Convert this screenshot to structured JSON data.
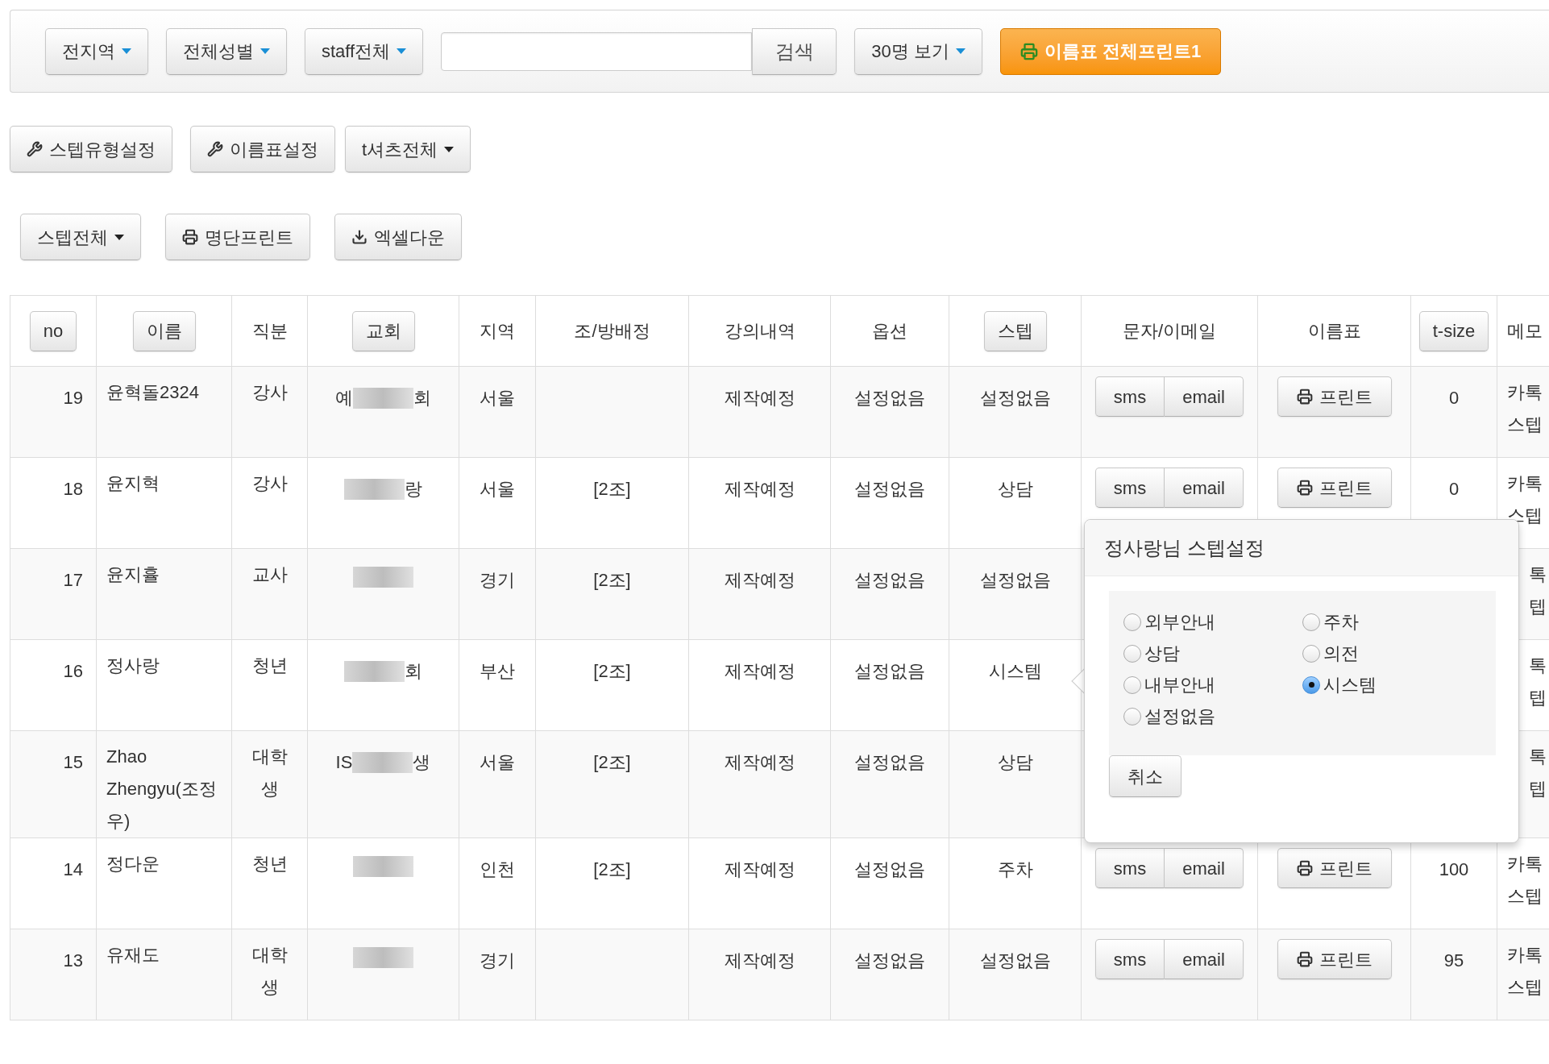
{
  "top_bar": [
    {
      "kind": "dropdown",
      "label": "전지역"
    },
    {
      "kind": "dropdown",
      "label": "전체성별"
    },
    {
      "kind": "dropdown",
      "label": "staff전체"
    },
    {
      "kind": "search",
      "label": "검색"
    },
    {
      "kind": "dropdown",
      "label": "30명 보기"
    },
    {
      "kind": "primary",
      "label": "이름표 전체프린트1"
    }
  ],
  "toolbar_1": [
    {
      "kind": "wrench",
      "label": "스텝유형설정"
    },
    {
      "kind": "wrench",
      "label": "이름표설정"
    },
    {
      "kind": "dropdown",
      "label": "t셔츠전체"
    }
  ],
  "toolbar_2": [
    {
      "kind": "dropdown",
      "label": "스텝전체"
    },
    {
      "kind": "print",
      "label": "명단프린트"
    },
    {
      "kind": "download",
      "label": "엑셀다운"
    }
  ],
  "table": {
    "columns": [
      {
        "label": "no",
        "kind": "button"
      },
      {
        "label": "이름",
        "kind": "button"
      },
      {
        "label": "직분",
        "kind": "text"
      },
      {
        "label": "교회",
        "kind": "button"
      },
      {
        "label": "지역",
        "kind": "text"
      },
      {
        "label": "조/방배정",
        "kind": "text"
      },
      {
        "label": "강의내역",
        "kind": "text"
      },
      {
        "label": "옵션",
        "kind": "text"
      },
      {
        "label": "스텝",
        "kind": "button"
      },
      {
        "label": "문자/이메일",
        "kind": "text"
      },
      {
        "label": "이름표",
        "kind": "text"
      },
      {
        "label": "t-size",
        "kind": "button"
      },
      {
        "label": "메모",
        "kind": "text"
      }
    ],
    "rows": [
      {
        "no": "19",
        "name": "윤혁돌2324",
        "role": "강사",
        "church": {
          "prefix": "예",
          "suffix": "회"
        },
        "region": "서울",
        "group": "",
        "lecture": "제작예정",
        "option": "설정없음",
        "step": "설정없음",
        "sms": "sms",
        "email": "email",
        "print": "프린트",
        "tsize": "0",
        "memo": [
          "카톡",
          "스텝"
        ]
      },
      {
        "no": "18",
        "name": "윤지혁",
        "role": "강사",
        "church": {
          "suffix": "랑"
        },
        "region": "서울",
        "group": "[2조]",
        "lecture": "제작예정",
        "option": "설정없음",
        "step": "상담",
        "sms": "sms",
        "email": "email",
        "print": "프린트",
        "tsize": "0",
        "memo": [
          "카톡",
          "스텝"
        ]
      },
      {
        "no": "17",
        "name": "윤지휼",
        "role": "교사",
        "church": {},
        "region": "경기",
        "group": "[2조]",
        "lecture": "제작예정",
        "option": "설정없음",
        "step": "설정없음",
        "memo": [
          "톡",
          "텝"
        ]
      },
      {
        "no": "16",
        "name": "정사랑",
        "role": "청년",
        "church": {
          "suffix": "회"
        },
        "region": "부산",
        "group": "[2조]",
        "lecture": "제작예정",
        "option": "설정없음",
        "step": "시스템",
        "memo": [
          "톡",
          "텝"
        ]
      },
      {
        "no": "15",
        "name": "Zhao Zhengyu(조정우)",
        "role": "대학생",
        "church": {
          "prefix": "IS",
          "suffix": "생"
        },
        "region": "서울",
        "group": "[2조]",
        "lecture": "제작예정",
        "option": "설정없음",
        "step": "상담",
        "memo": [
          "톡",
          "텝"
        ]
      },
      {
        "no": "14",
        "name": "정다운",
        "role": "청년",
        "church": {},
        "region": "인천",
        "group": "[2조]",
        "lecture": "제작예정",
        "option": "설정없음",
        "step": "주차",
        "sms": "sms",
        "email": "email",
        "print": "프린트",
        "tsize": "100",
        "memo": [
          "카톡",
          "스텝"
        ]
      },
      {
        "no": "13",
        "name": "유재도",
        "role": "대학생",
        "church": {},
        "region": "경기",
        "group": "",
        "lecture": "제작예정",
        "option": "설정없음",
        "step": "설정없음",
        "sms": "sms",
        "email": "email",
        "print": "프린트",
        "tsize": "95",
        "memo": [
          "카톡",
          "스텝"
        ]
      }
    ]
  },
  "popover": {
    "title": "정사랑님 스텝설정",
    "options": [
      {
        "label": "외부안내",
        "selected": false
      },
      {
        "label": "주차",
        "selected": false
      },
      {
        "label": "상담",
        "selected": false
      },
      {
        "label": "의전",
        "selected": false
      },
      {
        "label": "내부안내",
        "selected": false
      },
      {
        "label": "시스템",
        "selected": true
      },
      {
        "label": "설정없음",
        "selected": false
      }
    ],
    "cancel": "취소"
  }
}
